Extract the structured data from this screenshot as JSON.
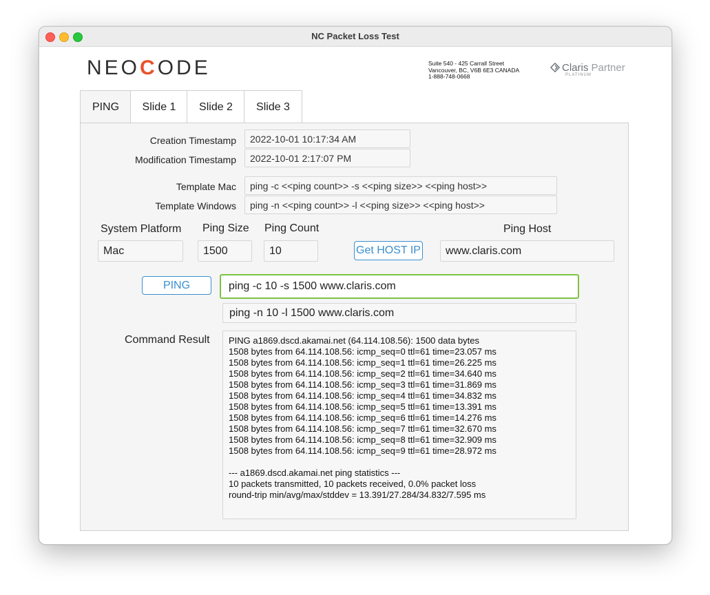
{
  "window": {
    "title": "NC Packet Loss Test"
  },
  "logo": {
    "pre": "NEO",
    "accent": "C",
    "post": "ODE"
  },
  "address": {
    "line1": "Suite 540 - 425 Carrall Street",
    "line2": "Vancouver, BC, V6B 6E3 CANADA",
    "line3": "1-888-748-0668"
  },
  "partner": {
    "brand": "Claris",
    "word": "Partner",
    "tier": "PLATINUM"
  },
  "tabs": [
    {
      "label": "PING"
    },
    {
      "label": "Slide 1"
    },
    {
      "label": "Slide 2"
    },
    {
      "label": "Slide 3"
    }
  ],
  "fields": {
    "creation_label": "Creation Timestamp",
    "creation_value": "2022-10-01 10:17:34 AM",
    "modification_label": "Modification Timestamp",
    "modification_value": "2022-10-01 2:17:07 PM",
    "template_mac_label": "Template Mac",
    "template_mac_value": "ping -c <<ping count>> -s <<ping size>> <<ping host>>",
    "template_win_label": "Template Windows",
    "template_win_value": "ping -n <<ping count>> -l <<ping size>> <<ping host>>"
  },
  "params": {
    "platform_label": "System Platform",
    "platform_value": "Mac",
    "size_label": "Ping Size",
    "size_value": "1500",
    "count_label": "Ping Count",
    "count_value": "10",
    "host_label": "Ping Host",
    "host_value": "www.claris.com",
    "get_host_button": "Get HOST IP"
  },
  "command": {
    "ping_button": "PING",
    "mac_command": "ping -c 10 -s 1500 www.claris.com",
    "win_command": "ping -n 10 -l 1500 www.claris.com",
    "result_label": "Command Result",
    "result_lines": [
      "PING a1869.dscd.akamai.net (64.114.108.56): 1500 data bytes",
      "1508 bytes from 64.114.108.56: icmp_seq=0 ttl=61 time=23.057 ms",
      "1508 bytes from 64.114.108.56: icmp_seq=1 ttl=61 time=26.225 ms",
      "1508 bytes from 64.114.108.56: icmp_seq=2 ttl=61 time=34.640 ms",
      "1508 bytes from 64.114.108.56: icmp_seq=3 ttl=61 time=31.869 ms",
      "1508 bytes from 64.114.108.56: icmp_seq=4 ttl=61 time=34.832 ms",
      "1508 bytes from 64.114.108.56: icmp_seq=5 ttl=61 time=13.391 ms",
      "1508 bytes from 64.114.108.56: icmp_seq=6 ttl=61 time=14.276 ms",
      "1508 bytes from 64.114.108.56: icmp_seq=7 ttl=61 time=32.670 ms",
      "1508 bytes from 64.114.108.56: icmp_seq=8 ttl=61 time=32.909 ms",
      "1508 bytes from 64.114.108.56: icmp_seq=9 ttl=61 time=28.972 ms",
      "",
      "--- a1869.dscd.akamai.net ping statistics ---",
      "10 packets transmitted, 10 packets received, 0.0% packet loss",
      "round-trip min/avg/max/stddev = 13.391/27.284/34.832/7.595 ms"
    ]
  },
  "colors": {
    "accent": "#e8522c",
    "link_blue": "#3a8fcf",
    "focus_green": "#7dc242"
  }
}
